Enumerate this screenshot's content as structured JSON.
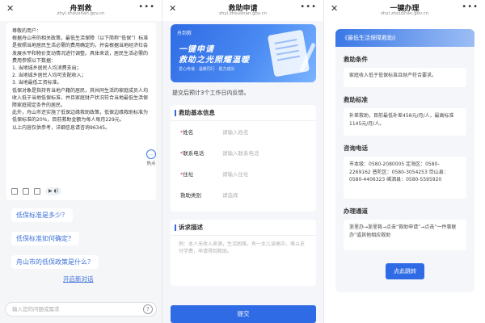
{
  "screen1": {
    "title": "舟到救",
    "subtitle": "zhyl.zhoushan.gov.cn",
    "answer_lines": [
      "尊敬的用户：",
      "根据舟山市的相关政策，最低生活保障（以下简称“低保”）标准是按照当地居民生活必需的费用确定的，并会根据当地经济社会发展水平和物价变动情况进行调整。具体来说，居民生活必需的费用参照以下数据：",
      "1. 当地城乡居民人均消费支出；",
      "2. 当地城乡居民人均可支配收入；",
      "3. 当地最低工资标准。",
      "低保对象是指持有当地户籍的居民，其共同生活的家庭成员人均收入低于当地低保标准，并且家庭财产状况符合当地最低生活保障家庭规定条件的居民。",
      "此外，舟山市还实施了低保边缘救助政策，低保边缘救助标准为低保标准的20%，目前救助金额为每人每月229元。",
      "以上内容仅供参考，详细信息请咨询96345。"
    ],
    "hot_label": "热点",
    "suggestions": [
      "低保标准是多少？",
      "低保标准如何确定？",
      "舟山市的低保政策是什么？"
    ],
    "new_chat": "开启新对话",
    "input_placeholder": "输入您的问题或需求"
  },
  "screen2": {
    "title": "救助申请",
    "subtitle": "zhyl.zhoushan.gov.cn",
    "banner": {
      "brand": "舟到救",
      "line1": "一键申请",
      "line2": "救助之光照耀温暖",
      "tags": "爱心传递 · 温暖同行 · 助力成长"
    },
    "notice": "提交后预计3个工作日内反馈。",
    "basic_title": "救助基本信息",
    "fields": [
      {
        "label": "姓名",
        "placeholder": "请输入姓名",
        "required": "*"
      },
      {
        "label": "联系电话",
        "placeholder": "请输入联系电话",
        "required": "*"
      },
      {
        "label": "住址",
        "placeholder": "请输入住址",
        "required": "*"
      },
      {
        "label": "救助类别",
        "placeholder": "请选择",
        "required": ""
      }
    ],
    "desc_title": "诉求描述",
    "desc_placeholder": "例：本人无收入来源，生活困难，有一女儿读高中，难以支付学费，申请得到救助。",
    "submit": "提交"
  },
  "screen3": {
    "title": "一键办理",
    "subtitle": "zhyl.zhoushan.gov.cn",
    "panel_title": "《最低生活保障救助》",
    "sections": [
      {
        "title": "救助条件",
        "body": "家庭收入低于低保标准且财产符合要求。"
      },
      {
        "title": "救助标准",
        "body": "补差救助，目前最低补差458元/月/人，最高标准1145元/月/人。"
      },
      {
        "title": "咨询电话",
        "body": "市本级：0580-2080005 定海区：0580-2269162 普陀区：0580-3054253 岱山县：0580-4406323 嵊泗县：0580-5595920"
      },
      {
        "title": "办理通道",
        "body": "浙里办→浙里救→点击“救助申请”→点击“一件事联办”或其他相应救助"
      }
    ],
    "jump": "点此跳转"
  }
}
